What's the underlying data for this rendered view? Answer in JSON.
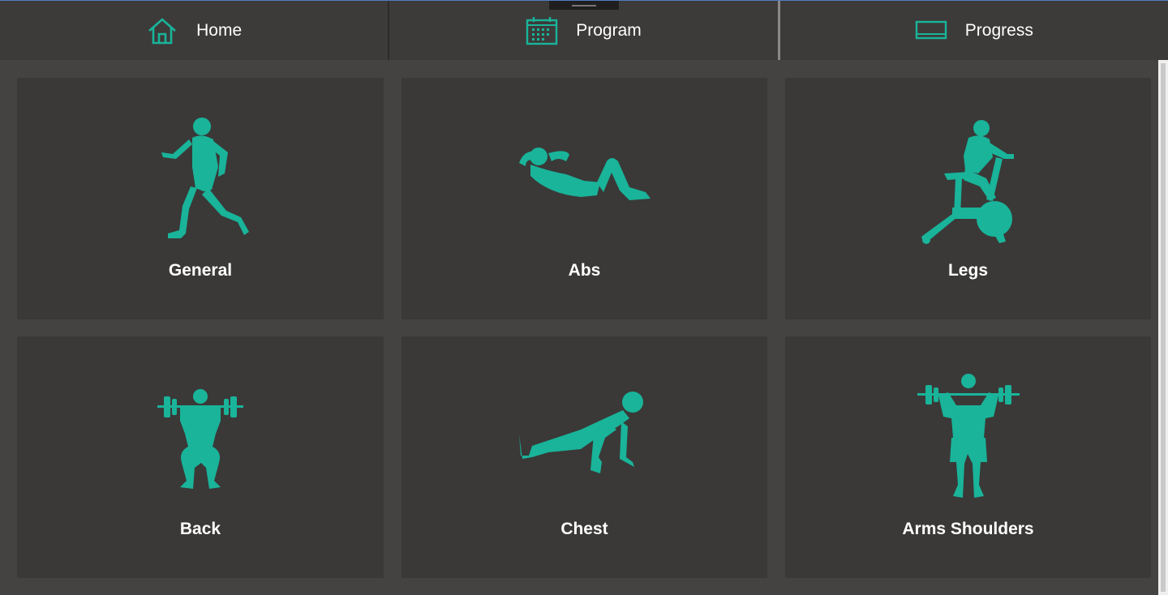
{
  "nav": {
    "items": [
      {
        "label": "Home",
        "icon": "home-icon"
      },
      {
        "label": "Program",
        "icon": "calendar-icon"
      },
      {
        "label": "Progress",
        "icon": "progress-icon"
      }
    ]
  },
  "tiles": [
    {
      "label": "General",
      "icon": "running-figure-icon"
    },
    {
      "label": "Abs",
      "icon": "situp-figure-icon"
    },
    {
      "label": "Legs",
      "icon": "exercise-bike-figure-icon"
    },
    {
      "label": "Back",
      "icon": "squat-barbell-figure-icon"
    },
    {
      "label": "Chest",
      "icon": "pushup-figure-icon"
    },
    {
      "label": "Arms Shoulders",
      "icon": "standing-barbell-figure-icon"
    }
  ],
  "colors": {
    "accent": "#19b49a",
    "tile_bg": "#3a3938",
    "page_bg": "#444342",
    "nav_bg": "#3c3b3a",
    "text": "#ffffff"
  }
}
